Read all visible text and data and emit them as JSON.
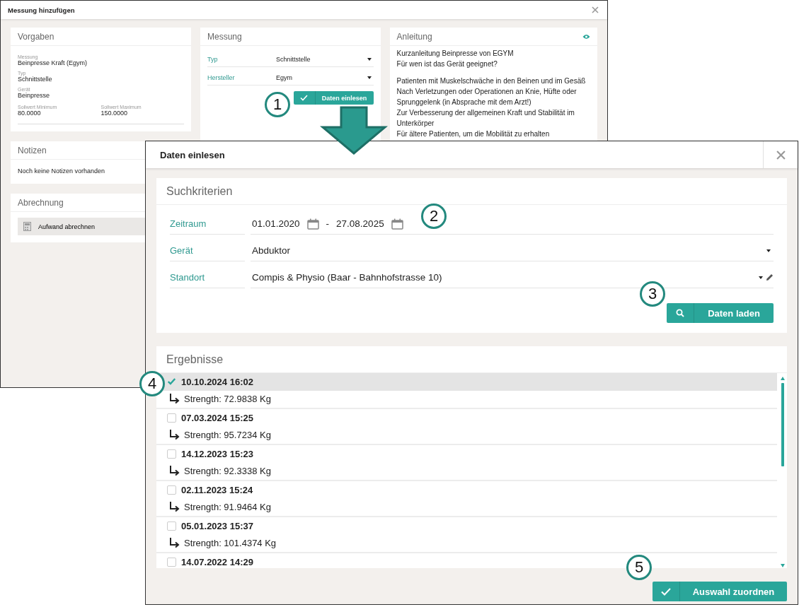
{
  "back_dialog": {
    "title": "Messung hinzufügen",
    "vorgaben": {
      "title": "Vorgaben",
      "fields": [
        {
          "label": "Messung",
          "value": "Beinpresse Kraft (Egym)"
        },
        {
          "label": "Typ",
          "value": "Schnittstelle"
        },
        {
          "label": "Gerät",
          "value": "Beinpresse"
        }
      ],
      "pair": [
        {
          "label": "Sollwert Minimum",
          "value": "80.0000"
        },
        {
          "label": "Sollwert Maximum",
          "value": "150.0000"
        }
      ]
    },
    "notizen": {
      "title": "Notizen",
      "text": "Noch keine Notizen vorhanden"
    },
    "abrechnung": {
      "title": "Abrechnung",
      "button": "Aufwand abrechnen"
    },
    "messung": {
      "title": "Messung",
      "fields": [
        {
          "label": "Typ",
          "value": "Schnittstelle"
        },
        {
          "label": "Hersteller",
          "value": "Egym"
        }
      ],
      "button": "Daten einlesen"
    },
    "anleitung": {
      "title": "Anleitung",
      "paragraphs": [
        [
          "Kurzanleitung Beinpresse von EGYM",
          "Für wen ist das Gerät geeignet?"
        ],
        [
          "Patienten mit Muskelschwäche in den Beinen und im Gesäß",
          "Nach Verletzungen oder Operationen an Knie, Hüfte oder Sprunggelenk (in Absprache mit dem Arzt!)",
          "Zur Verbesserung der allgemeinen Kraft und Stabilität im Unterkörper",
          "Für ältere Patienten, um die Mobilität zu erhalten"
        ]
      ]
    }
  },
  "front_dialog": {
    "title": "Daten einlesen",
    "suchkriterien": {
      "title": "Suchkriterien",
      "zeitraum": {
        "label": "Zeitraum",
        "from": "01.01.2020",
        "separator": "-",
        "to": "27.08.2025"
      },
      "geraet": {
        "label": "Gerät",
        "value": "Abduktor"
      },
      "standort": {
        "label": "Standort",
        "value": "Compis & Physio (Baar - Bahnhofstrasse 10)"
      },
      "button": "Daten laden"
    },
    "ergebnisse": {
      "title": "Ergebnisse",
      "rows": [
        {
          "date": "10.10.2024 16:02",
          "value": "Strength: 72.9838 Kg",
          "checked": true
        },
        {
          "date": "07.03.2024 15:25",
          "value": "Strength: 95.7234 Kg",
          "checked": false
        },
        {
          "date": "14.12.2023 15:23",
          "value": "Strength: 92.3338 Kg",
          "checked": false
        },
        {
          "date": "02.11.2023 15:24",
          "value": "Strength: 91.9464 Kg",
          "checked": false
        },
        {
          "date": "05.01.2023 15:37",
          "value": "Strength: 101.4374 Kg",
          "checked": false
        },
        {
          "date": "14.07.2022 14:29",
          "checked": false
        }
      ]
    },
    "button": "Auswahl zuordnen"
  },
  "callouts": [
    "1",
    "2",
    "3",
    "4",
    "5"
  ]
}
